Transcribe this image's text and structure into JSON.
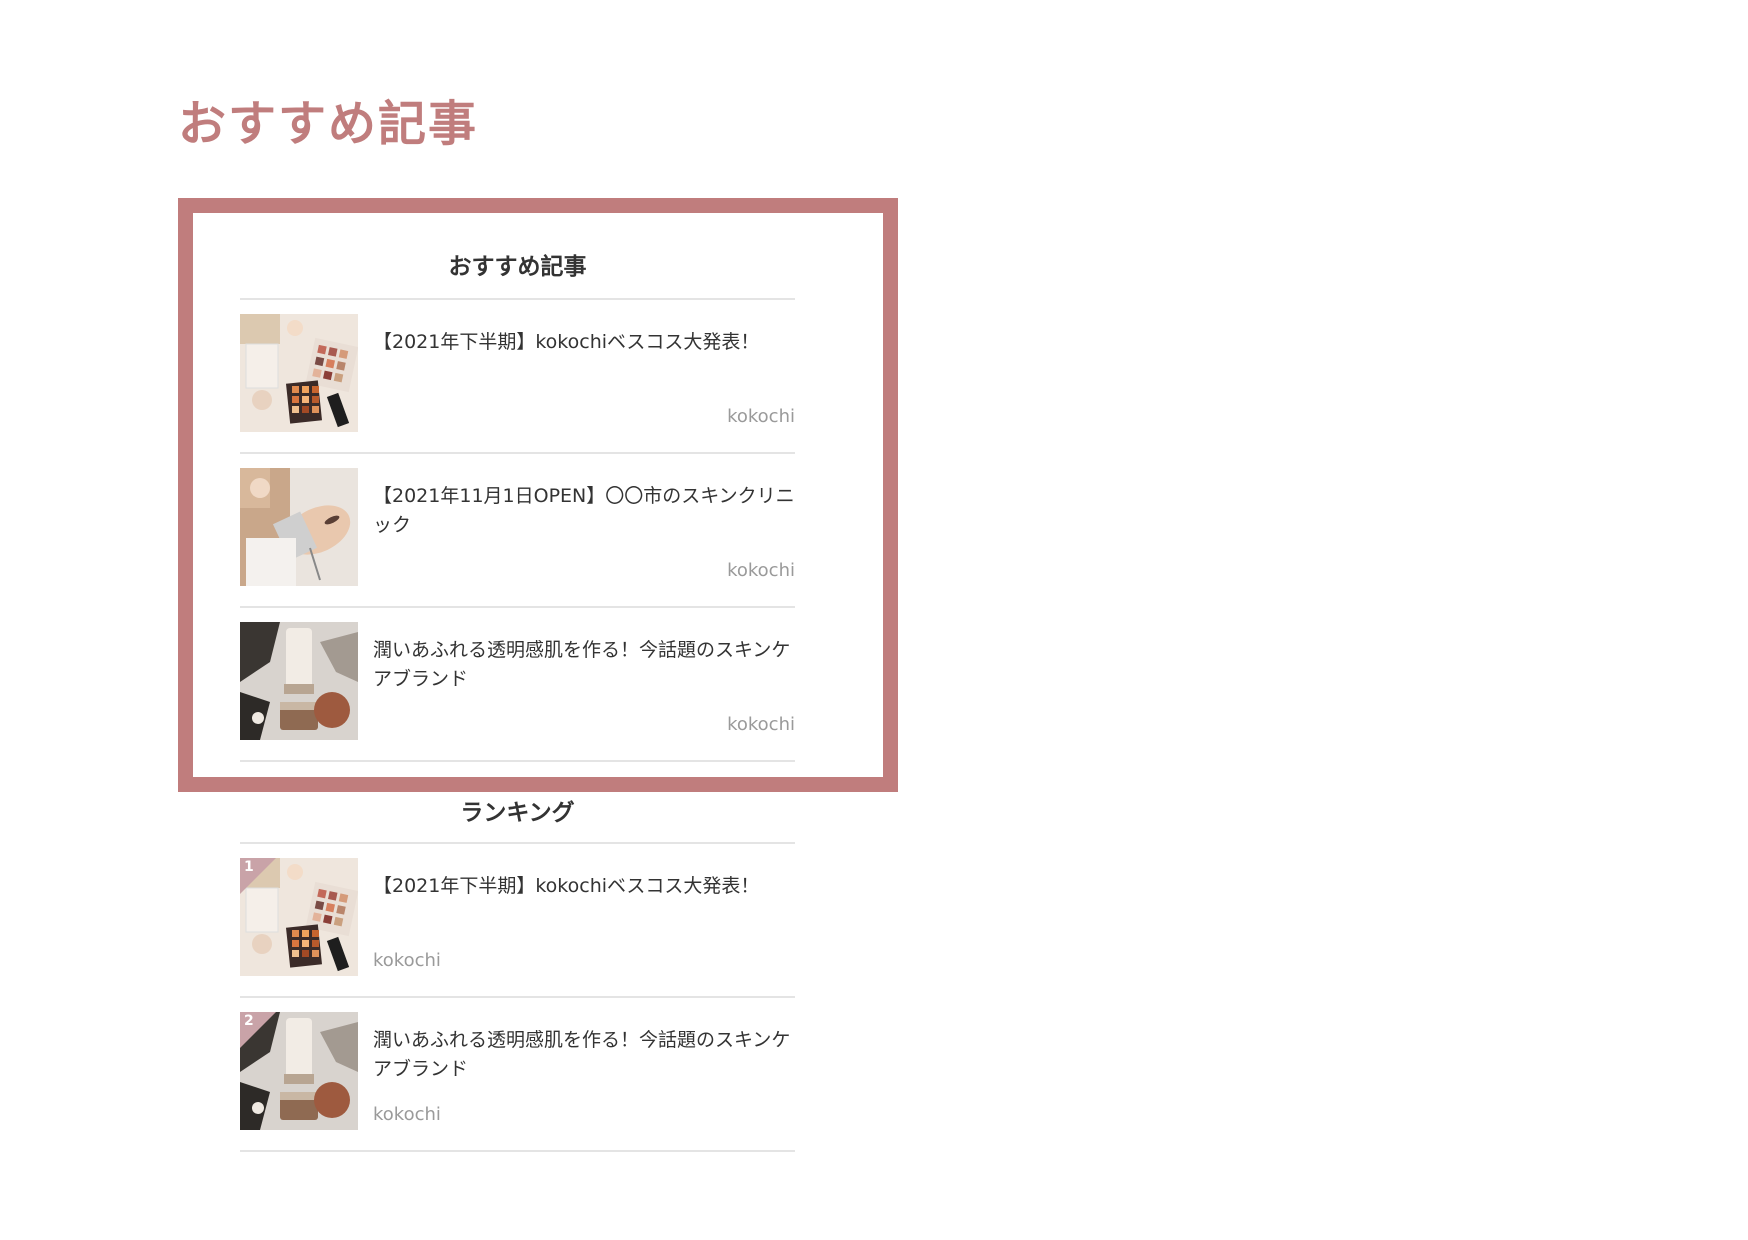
{
  "page_heading": "おすすめ記事",
  "recommended": {
    "title": "おすすめ記事",
    "articles": [
      {
        "title": "【2021年下半期】kokochiベスコス大発表！",
        "author": "kokochi"
      },
      {
        "title": "【2021年11月1日OPEN】〇〇市のスキンクリニック",
        "author": "kokochi"
      },
      {
        "title": "潤いあふれる透明感肌を作る！今話題のスキンケアブランド",
        "author": "kokochi"
      }
    ]
  },
  "ranking": {
    "title": "ランキング",
    "articles": [
      {
        "rank": "1",
        "title": "【2021年下半期】kokochiベスコス大発表！",
        "author": "kokochi"
      },
      {
        "rank": "2",
        "title": "潤いあふれる透明感肌を作る！今話題のスキンケアブランド",
        "author": "kokochi"
      }
    ]
  },
  "colors": {
    "accent": "#c07d7d",
    "badge": "#c9a3a8",
    "rule": "#e4e4e4",
    "meta": "#9a9a9a"
  }
}
